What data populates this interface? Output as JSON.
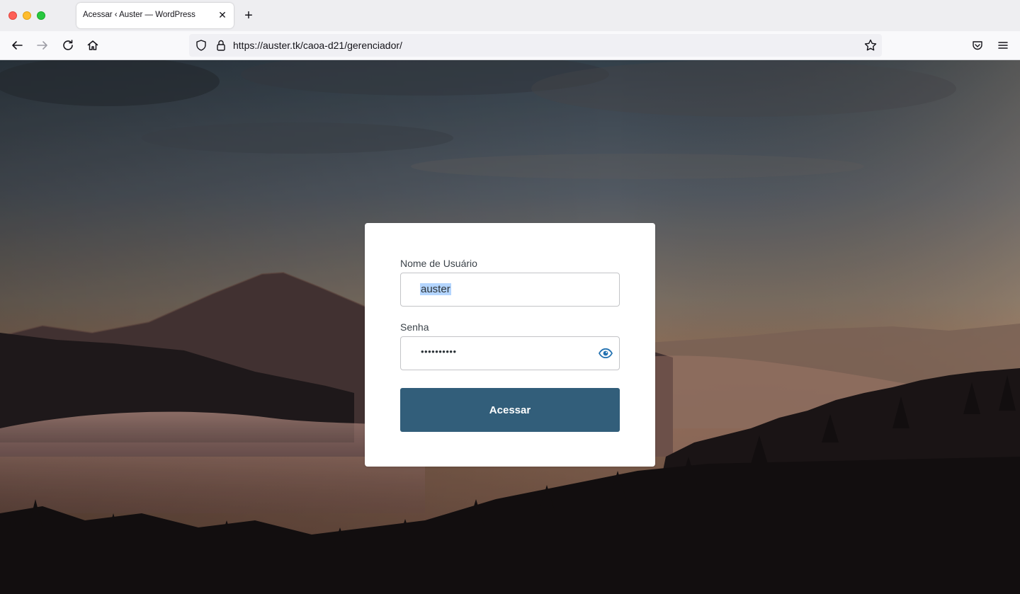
{
  "browser": {
    "tab_title": "Acessar ‹ Auster — WordPress",
    "tab_close_glyph": "✕",
    "new_tab_glyph": "+",
    "url": "https://auster.tk/caoa-d21/gerenciador/",
    "icons": [
      "back-icon",
      "forward-icon",
      "reload-icon",
      "home-icon",
      "shield-icon",
      "lock-icon",
      "star-icon",
      "pocket-icon",
      "menu-icon"
    ]
  },
  "login": {
    "username_label": "Nome de Usuário",
    "username_value": "auster",
    "password_label": "Senha",
    "password_value": "••••••••••",
    "submit_label": "Acessar"
  },
  "colors": {
    "accent": "#325e7a",
    "eye_icon": "#2271b1",
    "selection": "#b4d5fe"
  }
}
